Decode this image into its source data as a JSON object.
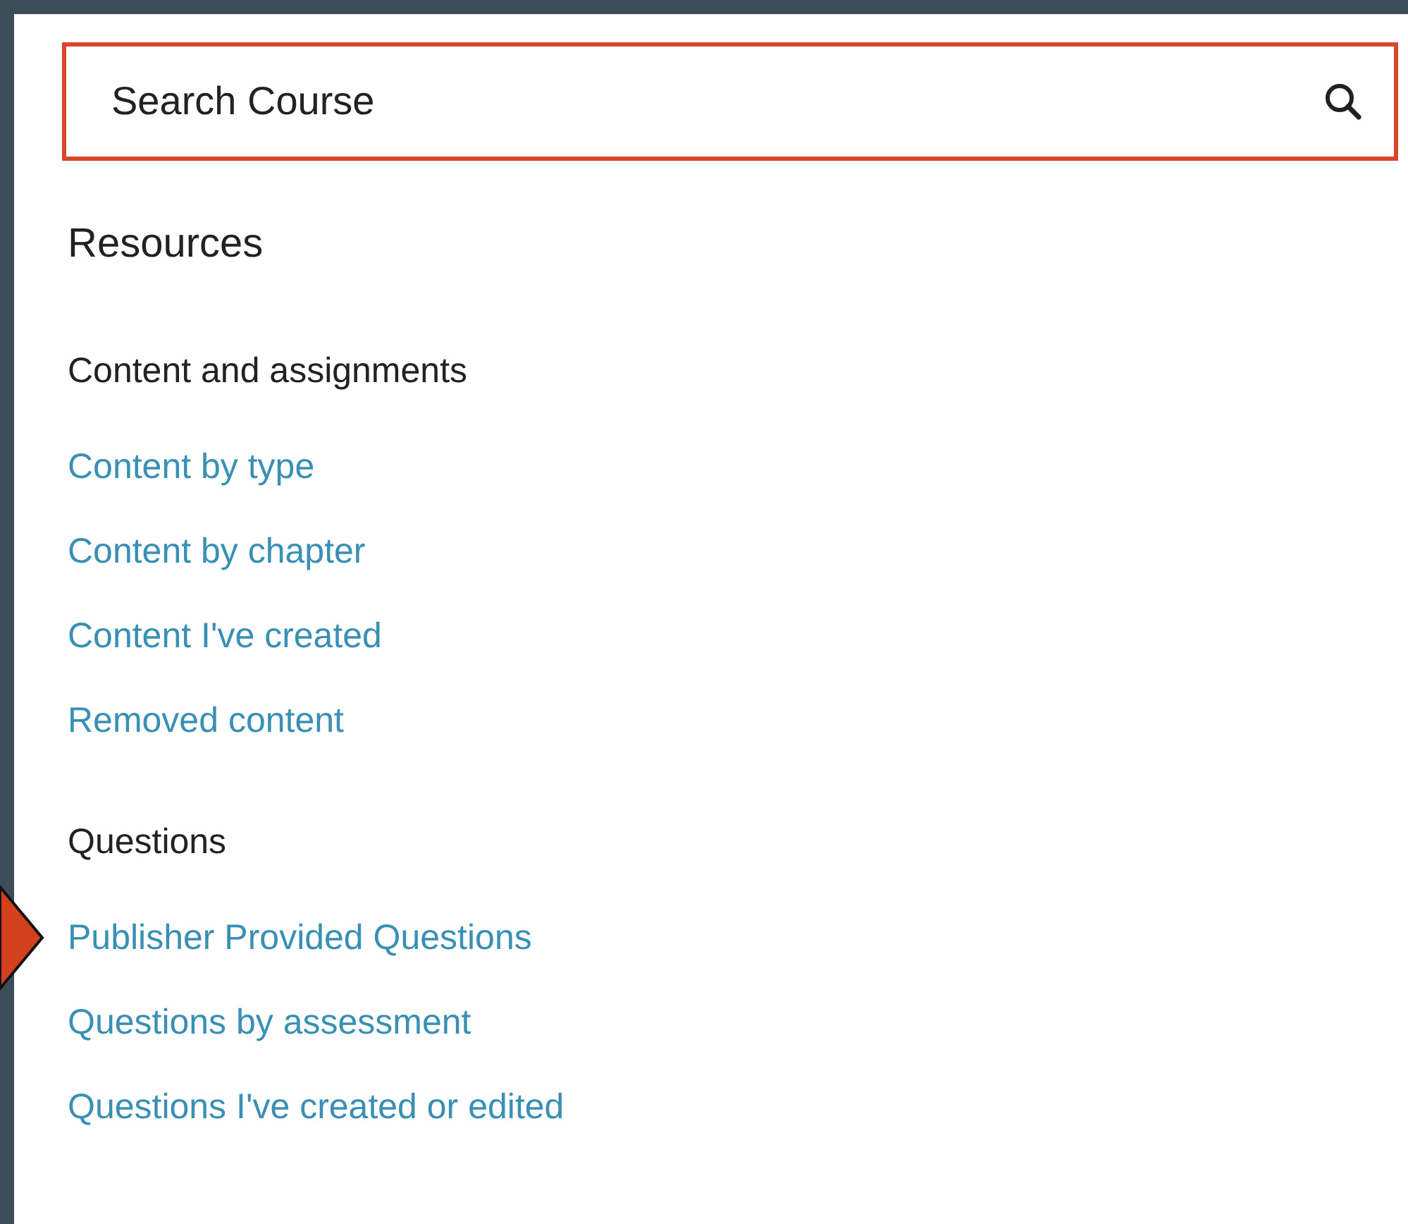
{
  "search": {
    "placeholder": "Search Course"
  },
  "title": "Resources",
  "sections": [
    {
      "heading": "Content and assignments",
      "links": [
        {
          "label": "Content by type",
          "pointed": false
        },
        {
          "label": "Content by chapter",
          "pointed": false
        },
        {
          "label": "Content I've created",
          "pointed": false
        },
        {
          "label": "Removed content",
          "pointed": false
        }
      ]
    },
    {
      "heading": "Questions",
      "links": [
        {
          "label": "Publisher Provided Questions",
          "pointed": true
        },
        {
          "label": "Questions by assessment",
          "pointed": false
        },
        {
          "label": "Questions I've created or edited",
          "pointed": false
        }
      ]
    }
  ]
}
